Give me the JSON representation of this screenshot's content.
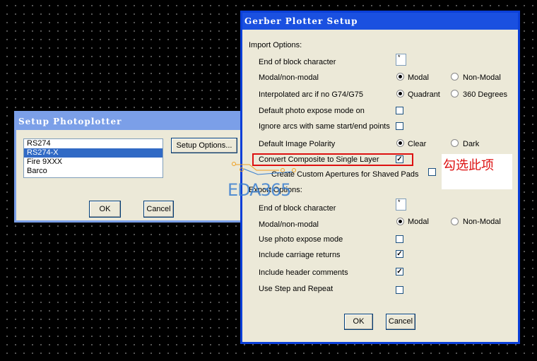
{
  "photoplotter": {
    "title": "Setup Photoplotter",
    "list": [
      "RS274",
      "RS274-X",
      "Fire 9XXX",
      "Barco"
    ],
    "selected_index": 1,
    "setup_button": "Setup Options...",
    "ok": "OK",
    "cancel": "Cancel"
  },
  "gerber": {
    "title": "Gerber Plotter Setup",
    "import_header": "Import Options:",
    "export_header": "Export Options:",
    "import": {
      "eob": {
        "label": "End of block character",
        "value": "*"
      },
      "modal": {
        "label": "Modal/non-modal",
        "opt1": "Modal",
        "opt2": "Non-Modal",
        "selected": "Modal"
      },
      "interp": {
        "label": "Interpolated arc if no G74/G75",
        "opt1": "Quadrant",
        "opt2": "360 Degrees",
        "selected": "Quadrant"
      },
      "photo": {
        "label": "Default photo expose mode on",
        "checked": false
      },
      "ignore": {
        "label": "Ignore arcs with same start/end points",
        "checked": false
      },
      "polarity": {
        "label": "Default Image Polarity",
        "opt1": "Clear",
        "opt2": "Dark",
        "selected": "Clear"
      },
      "composite": {
        "label": "Convert Composite to Single Layer",
        "checked": true
      },
      "apertures": {
        "label": "Create Custom Apertures for Shaved Pads",
        "checked": false
      }
    },
    "export": {
      "eob": {
        "label": "End of block character",
        "value": "*"
      },
      "modal": {
        "label": "Modal/non-modal",
        "opt1": "Modal",
        "opt2": "Non-Modal",
        "selected": "Modal"
      },
      "photo": {
        "label": "Use photo expose mode",
        "checked": false
      },
      "carriage": {
        "label": "Include carriage returns",
        "checked": true
      },
      "header": {
        "label": "Include header comments",
        "checked": true
      },
      "step": {
        "label": "Use Step and Repeat",
        "checked": false
      }
    },
    "ok": "OK",
    "cancel": "Cancel"
  },
  "annotation": "勾选此项",
  "watermark": "EDA365",
  "colors": {
    "highlight": "#dd1111",
    "titlebar": "#1a50e0"
  }
}
